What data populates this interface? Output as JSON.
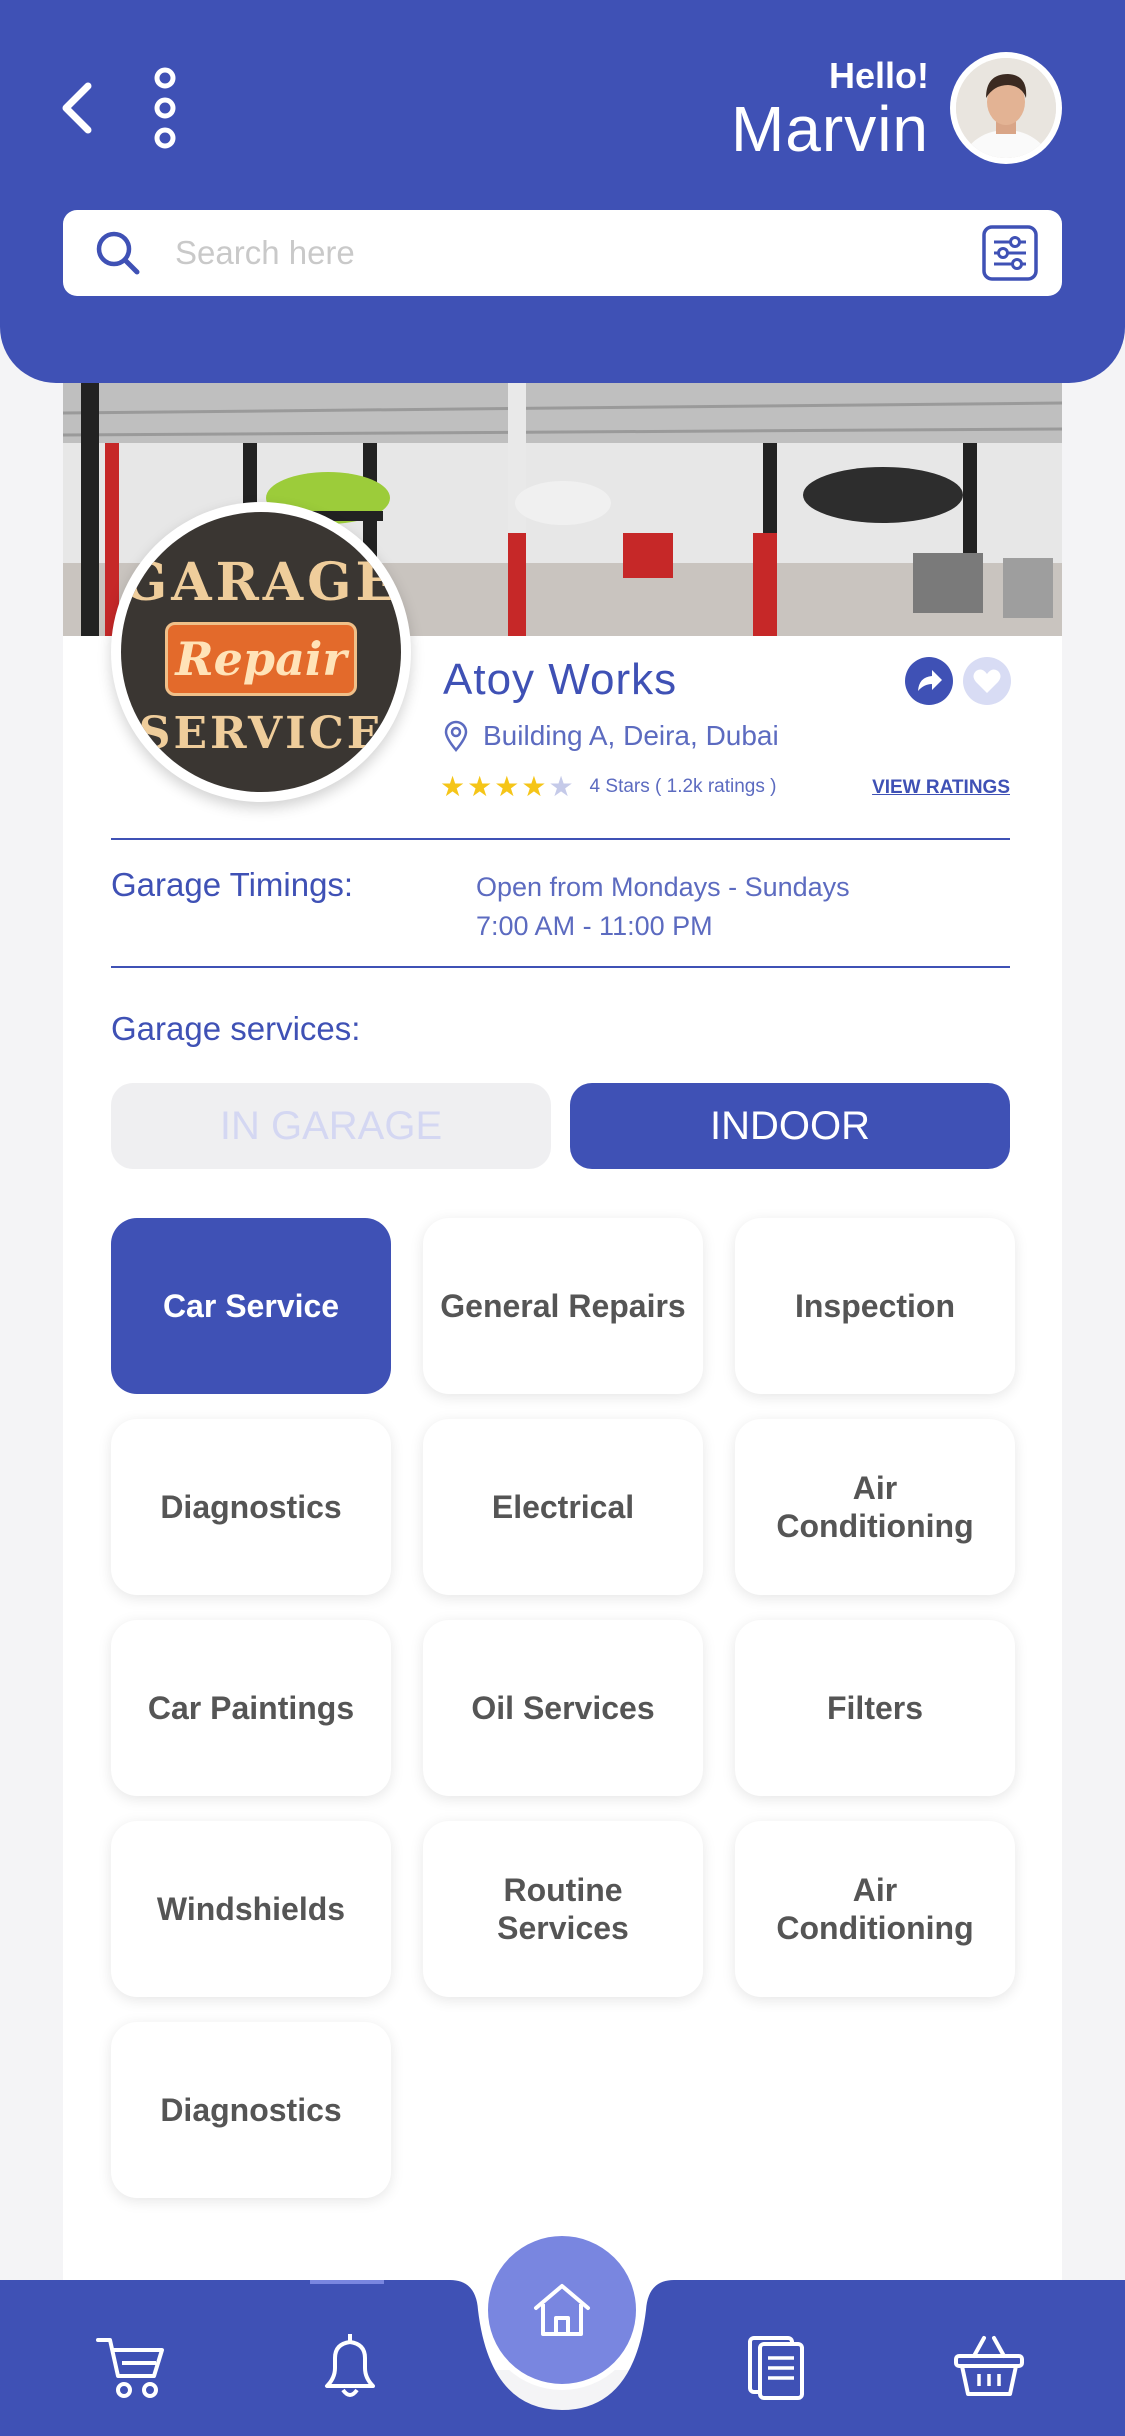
{
  "header": {
    "greeting": "Hello!",
    "user_name": "Marvin",
    "back_icon": "chevron-left-icon",
    "more_icon": "vertical-dots-icon"
  },
  "search": {
    "placeholder": "Search here",
    "value": ""
  },
  "garage": {
    "name": "Atoy Works",
    "address": "Building A, Deira, Dubai",
    "stars": 4,
    "max_stars": 5,
    "rating_text": "4 Stars ( 1.2k ratings )",
    "view_ratings_label": "VIEW RATINGS",
    "logo": {
      "top_text": "GARAGE",
      "middle_text": "Repair",
      "bottom_text": "SERVICE"
    }
  },
  "timings": {
    "label": "Garage Timings:",
    "line1": "Open from Mondays - Sundays",
    "line2": "7:00 AM - 11:00 PM"
  },
  "services": {
    "label": "Garage services:",
    "tabs": [
      {
        "label": "IN GARAGE",
        "active": false
      },
      {
        "label": "INDOOR",
        "active": true
      }
    ],
    "tiles": [
      {
        "label": "Car Service",
        "active": true
      },
      {
        "label": "General Repairs",
        "active": false
      },
      {
        "label": "Inspection",
        "active": false
      },
      {
        "label": "Diagnostics",
        "active": false
      },
      {
        "label": "Electrical",
        "active": false
      },
      {
        "label": "Air Conditioning",
        "active": false
      },
      {
        "label": "Car Paintings",
        "active": false
      },
      {
        "label": "Oil Services",
        "active": false
      },
      {
        "label": "Filters",
        "active": false
      },
      {
        "label": "Windshields",
        "active": false
      },
      {
        "label": "Routine Services",
        "active": false
      },
      {
        "label": "Air Conditioning",
        "active": false
      },
      {
        "label": "Diagnostics",
        "active": false
      }
    ]
  },
  "bottom_nav": {
    "items": [
      "cart-icon",
      "bell-icon",
      "home-icon",
      "document-icon",
      "basket-icon"
    ],
    "active": "home-icon"
  },
  "colors": {
    "primary": "#3f51b5",
    "primary_light": "#7986e0",
    "star": "#f5c518"
  }
}
